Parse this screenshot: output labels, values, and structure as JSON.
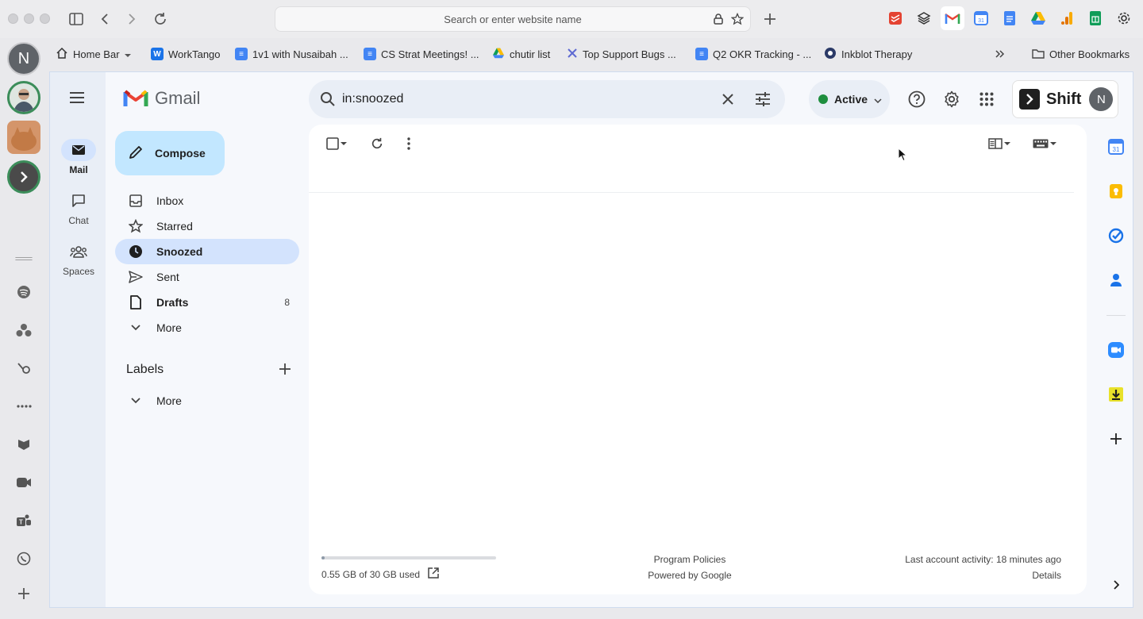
{
  "browser": {
    "url_placeholder": "Search or enter website name"
  },
  "bookmarks": [
    {
      "label": "Home Bar"
    },
    {
      "label": "WorkTango"
    },
    {
      "label": "1v1 with Nusaibah ..."
    },
    {
      "label": "CS Strat Meetings! ..."
    },
    {
      "label": "chutir list"
    },
    {
      "label": "Top Support Bugs ..."
    },
    {
      "label": "Q2 OKR Tracking - ..."
    },
    {
      "label": "Inkblot Therapy"
    }
  ],
  "other_bookmarks": "Other Bookmarks",
  "rail": {
    "account_initial": "N"
  },
  "gmail": {
    "logo_text": "Gmail",
    "nav": {
      "mail": "Mail",
      "chat": "Chat",
      "spaces": "Spaces"
    },
    "compose": "Compose",
    "folders": [
      {
        "label": "Inbox",
        "count": ""
      },
      {
        "label": "Starred",
        "count": ""
      },
      {
        "label": "Snoozed",
        "count": ""
      },
      {
        "label": "Sent",
        "count": ""
      },
      {
        "label": "Drafts",
        "count": "8"
      },
      {
        "label": "More",
        "count": ""
      }
    ],
    "labels_heading": "Labels",
    "labels_more": "More",
    "search_value": "in:snoozed",
    "status": "Active",
    "shift_text": "Shift",
    "avatar_initial": "N",
    "storage": {
      "used_text": "0.55 GB of 30 GB used",
      "fraction": 0.018
    },
    "footer": {
      "program_policies": "Program Policies",
      "powered_by": "Powered by Google",
      "last_activity": "Last account activity: 18 minutes ago",
      "details": "Details"
    }
  },
  "colors": {
    "compose_bg": "#c2e7ff",
    "active_item_bg": "#d3e3fd",
    "status_dot": "#1e8e3e"
  }
}
